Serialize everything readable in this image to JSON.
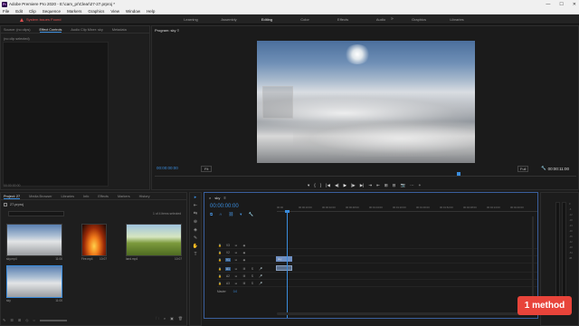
{
  "window": {
    "title": "Adobe Premiere Pro 2020 - E:\\cam_pr\\Clear\\27-27.prproj *",
    "app_icon_text": "Pr",
    "controls": [
      "—",
      "☐",
      "✕"
    ]
  },
  "menu": [
    "File",
    "Edit",
    "Clip",
    "Sequence",
    "Markers",
    "Graphics",
    "View",
    "Window",
    "Help"
  ],
  "warning": {
    "icon": "warning-icon",
    "text": "System Issues Found"
  },
  "workspaces": {
    "tabs": [
      "Learning",
      "Assembly",
      "Editing",
      "Color",
      "Effects",
      "Audio",
      "Graphics",
      "Libraries"
    ],
    "active_index": 2,
    "more": "»"
  },
  "effects_panel": {
    "tabs": [
      "Source: (no clips)",
      "Effect Controls",
      "Audio Clip Mixer: sky",
      "Metadata"
    ],
    "active_index": 1,
    "note": "(no clip selected)",
    "time": "00:00:00:00"
  },
  "program": {
    "title": "Program: sky",
    "menu_icon": "≡",
    "timecode_left": "00:00:00:00",
    "fit": "Fit",
    "full": "Full",
    "timecode_right": "00:00:11:00",
    "controls": [
      "▾",
      "{",
      "}",
      "|◀",
      "◀|",
      "▶",
      "|▶",
      "▶|",
      "⇥",
      "⇤",
      "⊞",
      "⊟",
      "📷",
      "⋯",
      "+"
    ]
  },
  "project": {
    "tabs": [
      "Project: 27",
      "Media Browser",
      "Libraries",
      "Info",
      "Effects",
      "Markers",
      "History"
    ],
    "active_index": 0,
    "file": "27.prproj",
    "count": "1 of 4 items selected",
    "items": [
      {
        "name": "sky.mp4",
        "duration": "11:00",
        "kind": "sky"
      },
      {
        "name": "Fire.mp4",
        "duration": "10:07",
        "kind": "fire"
      },
      {
        "name": "land.mp4",
        "duration": "10:07",
        "kind": "field"
      },
      {
        "name": "sky",
        "duration": "11:00",
        "kind": "sky"
      }
    ],
    "bottom_icons": [
      "✎",
      "☰",
      "⊞",
      "◇",
      "○"
    ],
    "bottom_right_icons": [
      "🗀",
      "⌕",
      "▣",
      "🗑"
    ]
  },
  "tools": [
    "▸",
    "⇤",
    "⇆",
    "⊕",
    "◈",
    "✎",
    "✋",
    "T"
  ],
  "timeline": {
    "title": "sky",
    "close": "×",
    "menu": "≡",
    "timecode": "00:00:00:00",
    "ruler_labels": [
      "00:00",
      "00:00:16:00",
      "00:00:32:00",
      "00:00:48:00",
      "00:01:04:00",
      "00:01:20:00",
      "00:01:36:00",
      "00:01:52:00",
      "00:02:08:00",
      "00:02:24:00",
      "00:02:40:00"
    ],
    "tracks": [
      {
        "name": "V3",
        "toggles": [
          "V3",
          "⊟",
          "◉"
        ]
      },
      {
        "name": "V2",
        "toggles": [
          "V2",
          "⊟",
          "◉"
        ]
      },
      {
        "name": "V1",
        "toggles": [
          "V1",
          "⊟",
          "◉"
        ]
      },
      {
        "name": "A1",
        "toggles": [
          "A1",
          "⊟",
          "M",
          "S",
          "🎤"
        ]
      },
      {
        "name": "A2",
        "toggles": [
          "A2",
          "⊟",
          "M",
          "S",
          "🎤"
        ]
      },
      {
        "name": "A3",
        "toggles": [
          "A3",
          "⊟",
          "M",
          "S",
          "🎤"
        ]
      }
    ],
    "master_label": "Master",
    "master_value": "0.0",
    "clip_v": "sky",
    "clip_a": ""
  },
  "meters": {
    "scale": [
      "0",
      "-6",
      "-12",
      "-18",
      "-24",
      "-30",
      "-36",
      "-42",
      "-48",
      "-54",
      "dB"
    ]
  },
  "badge": {
    "text": "1 method",
    "color": "#e8443a"
  }
}
